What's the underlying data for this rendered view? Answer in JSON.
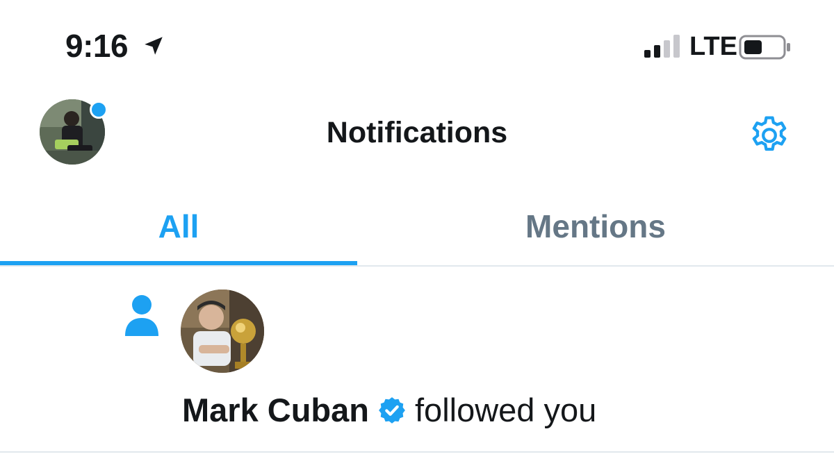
{
  "status_bar": {
    "time": "9:16",
    "network": "LTE",
    "icons": [
      "location-arrow-icon",
      "cellular-signal-icon",
      "battery-icon"
    ]
  },
  "header": {
    "title": "Notifications",
    "unread_indicator": true,
    "settings_icon": "gear-icon"
  },
  "tabs": [
    {
      "label": "All",
      "active": true
    },
    {
      "label": "Mentions",
      "active": false
    }
  ],
  "notifications": [
    {
      "type_icon": "follow-person-icon",
      "user": "Mark Cuban",
      "verified": true,
      "action": "followed you"
    }
  ],
  "colors": {
    "accent": "#1da1f2",
    "text_primary": "#14171a",
    "text_secondary": "#657786",
    "divider": "#e1e8ed"
  }
}
